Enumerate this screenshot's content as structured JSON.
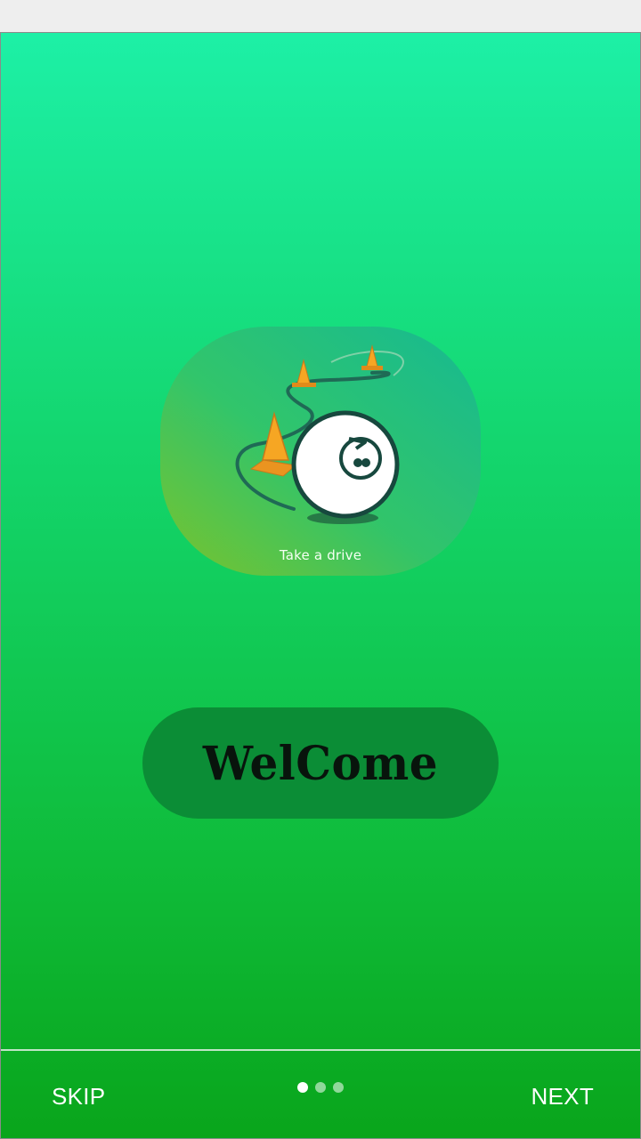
{
  "illustration": {
    "caption": "Take a drive",
    "icon": "robot-ball-with-cones"
  },
  "welcome": {
    "label": "WelCome"
  },
  "navigation": {
    "skip_label": "SKIP",
    "next_label": "NEXT",
    "page_count": 3,
    "current_page": 1
  },
  "colors": {
    "gradient_top": "#1df0a6",
    "gradient_bottom": "#09a51b",
    "welcome_pill": "#0b8d36",
    "cone_orange": "#f6a623"
  }
}
